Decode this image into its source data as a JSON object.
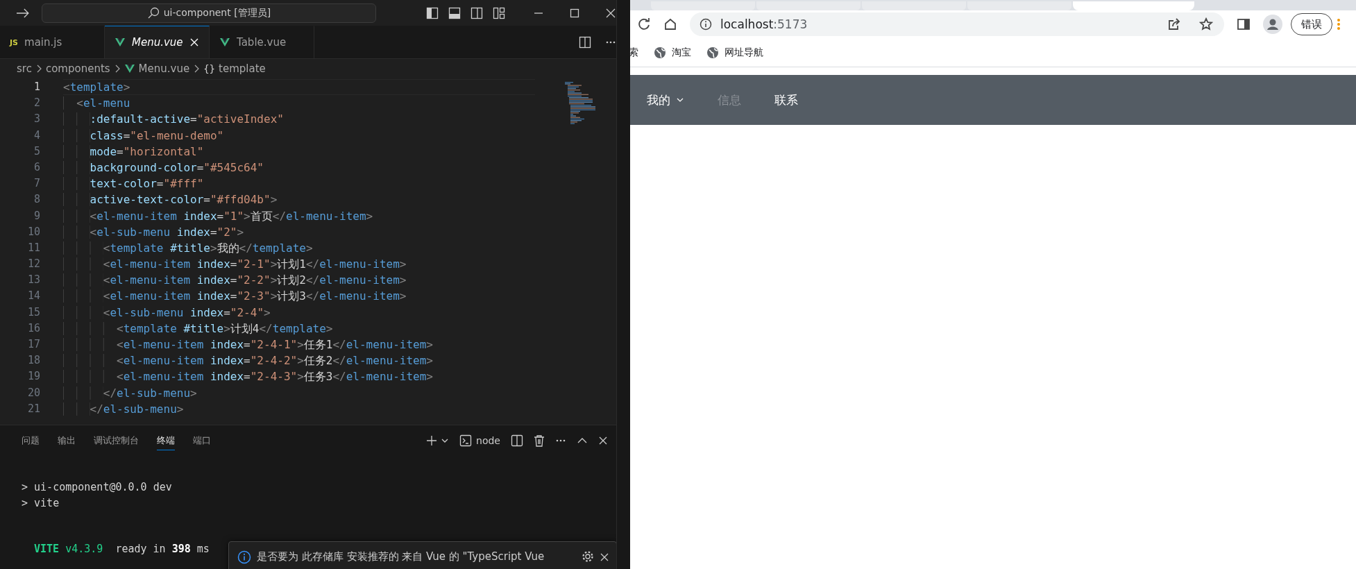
{
  "editor_window": {
    "title_bar": {
      "search": "ui-component [管理员]"
    },
    "tabs": [
      {
        "label": "main.js",
        "kind": "js",
        "icon_text": "JS",
        "selected": false,
        "preview": false
      },
      {
        "label": "Menu.vue",
        "kind": "vue",
        "selected": true,
        "preview": true
      },
      {
        "label": "Table.vue",
        "kind": "vue",
        "selected": false,
        "preview": false
      }
    ],
    "breadcrumb": [
      {
        "label": "src",
        "kind": "folder"
      },
      {
        "label": "components",
        "kind": "folder"
      },
      {
        "label": "Menu.vue",
        "kind": "vue"
      },
      {
        "label": "template",
        "kind": "symbol",
        "icon_text": "{}"
      }
    ],
    "code_lines": [
      {
        "number": "1",
        "current": true,
        "tokens": [
          {
            "kind": "punct",
            "text": "<"
          },
          {
            "kind": "tag",
            "text": "template"
          },
          {
            "kind": "punct",
            "text": ">"
          }
        ]
      },
      {
        "number": "2",
        "current": false,
        "tokens": [
          {
            "kind": "punct",
            "text": "  <"
          },
          {
            "kind": "tag",
            "text": "el-menu"
          }
        ]
      },
      {
        "number": "3",
        "current": false,
        "tokens": [
          {
            "kind": "attr",
            "text": "    :default-active"
          },
          {
            "kind": "plain",
            "text": "="
          },
          {
            "kind": "string",
            "text": "\"activeIndex\""
          }
        ]
      },
      {
        "number": "4",
        "current": false,
        "tokens": [
          {
            "kind": "attr",
            "text": "    class"
          },
          {
            "kind": "plain",
            "text": "="
          },
          {
            "kind": "string",
            "text": "\"el-menu-demo\""
          }
        ]
      },
      {
        "number": "5",
        "current": false,
        "tokens": [
          {
            "kind": "attr",
            "text": "    mode"
          },
          {
            "kind": "plain",
            "text": "="
          },
          {
            "kind": "string",
            "text": "\"horizontal\""
          }
        ]
      },
      {
        "number": "6",
        "current": false,
        "tokens": [
          {
            "kind": "attr",
            "text": "    background-color"
          },
          {
            "kind": "plain",
            "text": "="
          },
          {
            "kind": "string",
            "text": "\"#545c64\""
          }
        ]
      },
      {
        "number": "7",
        "current": false,
        "tokens": [
          {
            "kind": "attr",
            "text": "    text-color"
          },
          {
            "kind": "plain",
            "text": "="
          },
          {
            "kind": "string",
            "text": "\"#fff\""
          }
        ]
      },
      {
        "number": "8",
        "current": false,
        "tokens": [
          {
            "kind": "attr",
            "text": "    active-text-color"
          },
          {
            "kind": "plain",
            "text": "="
          },
          {
            "kind": "string",
            "text": "\"#ffd04b\""
          },
          {
            "kind": "punct",
            "text": ">"
          }
        ]
      },
      {
        "number": "9",
        "current": false,
        "tokens": [
          {
            "kind": "punct",
            "text": "    <"
          },
          {
            "kind": "tag",
            "text": "el-menu-item"
          },
          {
            "kind": "attr",
            "text": " index"
          },
          {
            "kind": "plain",
            "text": "="
          },
          {
            "kind": "string",
            "text": "\"1\""
          },
          {
            "kind": "punct",
            "text": ">"
          },
          {
            "kind": "plain",
            "text": "首页"
          },
          {
            "kind": "punct",
            "text": "</"
          },
          {
            "kind": "tag",
            "text": "el-menu-item"
          },
          {
            "kind": "punct",
            "text": ">"
          }
        ]
      },
      {
        "number": "10",
        "current": false,
        "tokens": [
          {
            "kind": "punct",
            "text": "    <"
          },
          {
            "kind": "tag",
            "text": "el-sub-menu"
          },
          {
            "kind": "attr",
            "text": " index"
          },
          {
            "kind": "plain",
            "text": "="
          },
          {
            "kind": "string",
            "text": "\"2\""
          },
          {
            "kind": "punct",
            "text": ">"
          }
        ]
      },
      {
        "number": "11",
        "current": false,
        "tokens": [
          {
            "kind": "punct",
            "text": "      <"
          },
          {
            "kind": "tag",
            "text": "template"
          },
          {
            "kind": "attr",
            "text": " #title"
          },
          {
            "kind": "punct",
            "text": ">"
          },
          {
            "kind": "plain",
            "text": "我的"
          },
          {
            "kind": "punct",
            "text": "</"
          },
          {
            "kind": "tag",
            "text": "template"
          },
          {
            "kind": "punct",
            "text": ">"
          }
        ]
      },
      {
        "number": "12",
        "current": false,
        "tokens": [
          {
            "kind": "punct",
            "text": "      <"
          },
          {
            "kind": "tag",
            "text": "el-menu-item"
          },
          {
            "kind": "attr",
            "text": " index"
          },
          {
            "kind": "plain",
            "text": "="
          },
          {
            "kind": "string",
            "text": "\"2-1\""
          },
          {
            "kind": "punct",
            "text": ">"
          },
          {
            "kind": "plain",
            "text": "计划1"
          },
          {
            "kind": "punct",
            "text": "</"
          },
          {
            "kind": "tag",
            "text": "el-menu-item"
          },
          {
            "kind": "punct",
            "text": ">"
          }
        ]
      },
      {
        "number": "13",
        "current": false,
        "tokens": [
          {
            "kind": "punct",
            "text": "      <"
          },
          {
            "kind": "tag",
            "text": "el-menu-item"
          },
          {
            "kind": "attr",
            "text": " index"
          },
          {
            "kind": "plain",
            "text": "="
          },
          {
            "kind": "string",
            "text": "\"2-2\""
          },
          {
            "kind": "punct",
            "text": ">"
          },
          {
            "kind": "plain",
            "text": "计划2"
          },
          {
            "kind": "punct",
            "text": "</"
          },
          {
            "kind": "tag",
            "text": "el-menu-item"
          },
          {
            "kind": "punct",
            "text": ">"
          }
        ]
      },
      {
        "number": "14",
        "current": false,
        "tokens": [
          {
            "kind": "punct",
            "text": "      <"
          },
          {
            "kind": "tag",
            "text": "el-menu-item"
          },
          {
            "kind": "attr",
            "text": " index"
          },
          {
            "kind": "plain",
            "text": "="
          },
          {
            "kind": "string",
            "text": "\"2-3\""
          },
          {
            "kind": "punct",
            "text": ">"
          },
          {
            "kind": "plain",
            "text": "计划3"
          },
          {
            "kind": "punct",
            "text": "</"
          },
          {
            "kind": "tag",
            "text": "el-menu-item"
          },
          {
            "kind": "punct",
            "text": ">"
          }
        ]
      },
      {
        "number": "15",
        "current": false,
        "tokens": [
          {
            "kind": "punct",
            "text": "      <"
          },
          {
            "kind": "tag",
            "text": "el-sub-menu"
          },
          {
            "kind": "attr",
            "text": " index"
          },
          {
            "kind": "plain",
            "text": "="
          },
          {
            "kind": "string",
            "text": "\"2-4\""
          },
          {
            "kind": "punct",
            "text": ">"
          }
        ]
      },
      {
        "number": "16",
        "current": false,
        "tokens": [
          {
            "kind": "punct",
            "text": "        <"
          },
          {
            "kind": "tag",
            "text": "template"
          },
          {
            "kind": "attr",
            "text": " #title"
          },
          {
            "kind": "punct",
            "text": ">"
          },
          {
            "kind": "plain",
            "text": "计划4"
          },
          {
            "kind": "punct",
            "text": "</"
          },
          {
            "kind": "tag",
            "text": "template"
          },
          {
            "kind": "punct",
            "text": ">"
          }
        ]
      },
      {
        "number": "17",
        "current": false,
        "tokens": [
          {
            "kind": "punct",
            "text": "        <"
          },
          {
            "kind": "tag",
            "text": "el-menu-item"
          },
          {
            "kind": "attr",
            "text": " index"
          },
          {
            "kind": "plain",
            "text": "="
          },
          {
            "kind": "string",
            "text": "\"2-4-1\""
          },
          {
            "kind": "punct",
            "text": ">"
          },
          {
            "kind": "plain",
            "text": "任务1"
          },
          {
            "kind": "punct",
            "text": "</"
          },
          {
            "kind": "tag",
            "text": "el-menu-item"
          },
          {
            "kind": "punct",
            "text": ">"
          }
        ]
      },
      {
        "number": "18",
        "current": false,
        "tokens": [
          {
            "kind": "punct",
            "text": "        <"
          },
          {
            "kind": "tag",
            "text": "el-menu-item"
          },
          {
            "kind": "attr",
            "text": " index"
          },
          {
            "kind": "plain",
            "text": "="
          },
          {
            "kind": "string",
            "text": "\"2-4-2\""
          },
          {
            "kind": "punct",
            "text": ">"
          },
          {
            "kind": "plain",
            "text": "任务2"
          },
          {
            "kind": "punct",
            "text": "</"
          },
          {
            "kind": "tag",
            "text": "el-menu-item"
          },
          {
            "kind": "punct",
            "text": ">"
          }
        ]
      },
      {
        "number": "19",
        "current": false,
        "tokens": [
          {
            "kind": "punct",
            "text": "        <"
          },
          {
            "kind": "tag",
            "text": "el-menu-item"
          },
          {
            "kind": "attr",
            "text": " index"
          },
          {
            "kind": "plain",
            "text": "="
          },
          {
            "kind": "string",
            "text": "\"2-4-3\""
          },
          {
            "kind": "punct",
            "text": ">"
          },
          {
            "kind": "plain",
            "text": "任务3"
          },
          {
            "kind": "punct",
            "text": "</"
          },
          {
            "kind": "tag",
            "text": "el-menu-item"
          },
          {
            "kind": "punct",
            "text": ">"
          }
        ]
      },
      {
        "number": "20",
        "current": false,
        "tokens": [
          {
            "kind": "punct",
            "text": "      </"
          },
          {
            "kind": "tag",
            "text": "el-sub-menu"
          },
          {
            "kind": "punct",
            "text": ">"
          }
        ]
      },
      {
        "number": "21",
        "current": false,
        "tokens": [
          {
            "kind": "punct",
            "text": "    </"
          },
          {
            "kind": "tag",
            "text": "el-sub-menu"
          },
          {
            "kind": "punct",
            "text": ">"
          }
        ]
      }
    ],
    "panel": {
      "tabs": [
        {
          "label": "问题",
          "selected": false
        },
        {
          "label": "输出",
          "selected": false
        },
        {
          "label": "调试控制台",
          "selected": false
        },
        {
          "label": "终端",
          "selected": true
        },
        {
          "label": "端口",
          "selected": false
        }
      ],
      "shell": "node",
      "terminal_lines": [
        {
          "kind": "command",
          "tokens": [
            {
              "kind": "plain",
              "text": "> ui-component@0.0.0 dev"
            }
          ]
        },
        {
          "kind": "command",
          "tokens": [
            {
              "kind": "plain",
              "text": "> vite"
            }
          ]
        },
        {
          "kind": "output",
          "tokens": [
            {
              "kind": "brand",
              "text": "VITE"
            },
            {
              "kind": "version",
              "text": " v4.3.9"
            },
            {
              "kind": "plain",
              "text": "  ready in "
            },
            {
              "kind": "bold",
              "text": "398"
            },
            {
              "kind": "plain",
              "text": " ms"
            }
          ]
        }
      ]
    },
    "notification": {
      "text": "是否要为 此存储库 安装推荐的 来自 Vue 的 \"TypeScript Vue"
    }
  },
  "browser": {
    "tabs": [
      {
        "selected": false
      },
      {
        "selected": false
      },
      {
        "selected": false
      },
      {
        "selected": false
      },
      {
        "selected": true
      }
    ],
    "address": {
      "host": "localhost",
      "port": ":5173"
    },
    "profile_button": "错误",
    "bookmarks": [
      {
        "label": "索",
        "icon": false
      },
      {
        "label": "淘宝",
        "icon": true
      },
      {
        "label": "网址导航",
        "icon": true
      }
    ],
    "page": {
      "menu": [
        {
          "label": "我的",
          "kind": "submenu",
          "disabled": false
        },
        {
          "label": "信息",
          "kind": "item",
          "disabled": true
        },
        {
          "label": "联系",
          "kind": "item",
          "disabled": false
        }
      ]
    }
  }
}
